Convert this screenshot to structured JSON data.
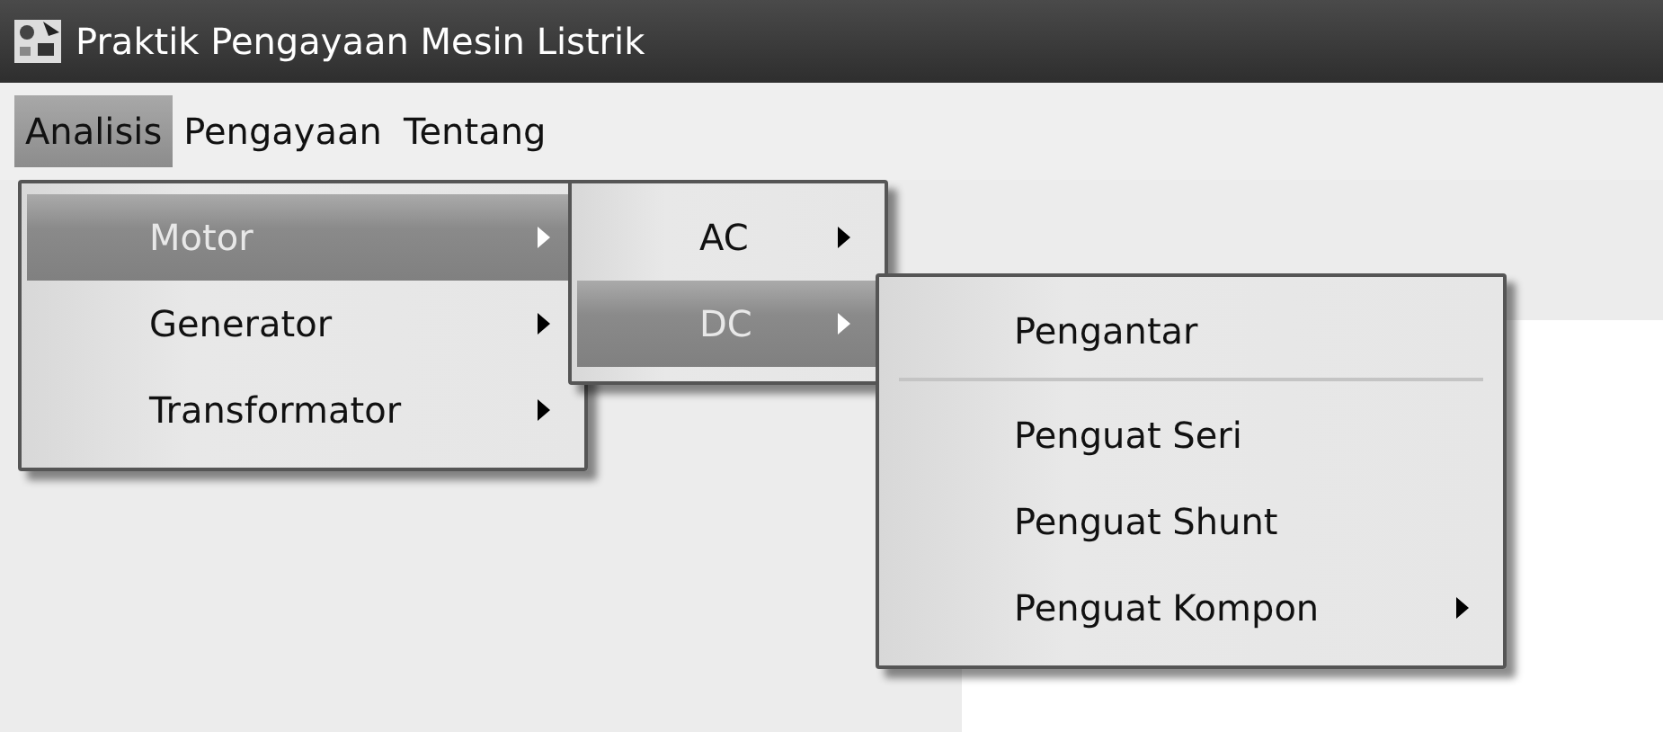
{
  "window": {
    "title": "Praktik Pengayaan Mesin Listrik"
  },
  "menu_bar": [
    {
      "label": "Analisis",
      "selected": true
    },
    {
      "label": "Pengayaan",
      "selected": false
    },
    {
      "label": "Tentang",
      "selected": false
    }
  ],
  "menus": [
    {
      "items": [
        {
          "kind": "item",
          "label": "Motor",
          "has_submenu": true,
          "selected": true
        },
        {
          "kind": "item",
          "label": "Generator",
          "has_submenu": true,
          "selected": false
        },
        {
          "kind": "item",
          "label": "Transformator",
          "has_submenu": true,
          "selected": false
        }
      ]
    },
    {
      "items": [
        {
          "kind": "item",
          "label": "AC",
          "has_submenu": true,
          "selected": false
        },
        {
          "kind": "item",
          "label": "DC",
          "has_submenu": true,
          "selected": true
        }
      ]
    },
    {
      "items": [
        {
          "kind": "item",
          "label": "Pengantar",
          "has_submenu": false,
          "selected": false
        },
        {
          "kind": "separator"
        },
        {
          "kind": "item",
          "label": "Penguat Seri",
          "has_submenu": false,
          "selected": false
        },
        {
          "kind": "item",
          "label": "Penguat Shunt",
          "has_submenu": false,
          "selected": false
        },
        {
          "kind": "item",
          "label": "Penguat Kompon",
          "has_submenu": true,
          "selected": false
        }
      ]
    }
  ]
}
